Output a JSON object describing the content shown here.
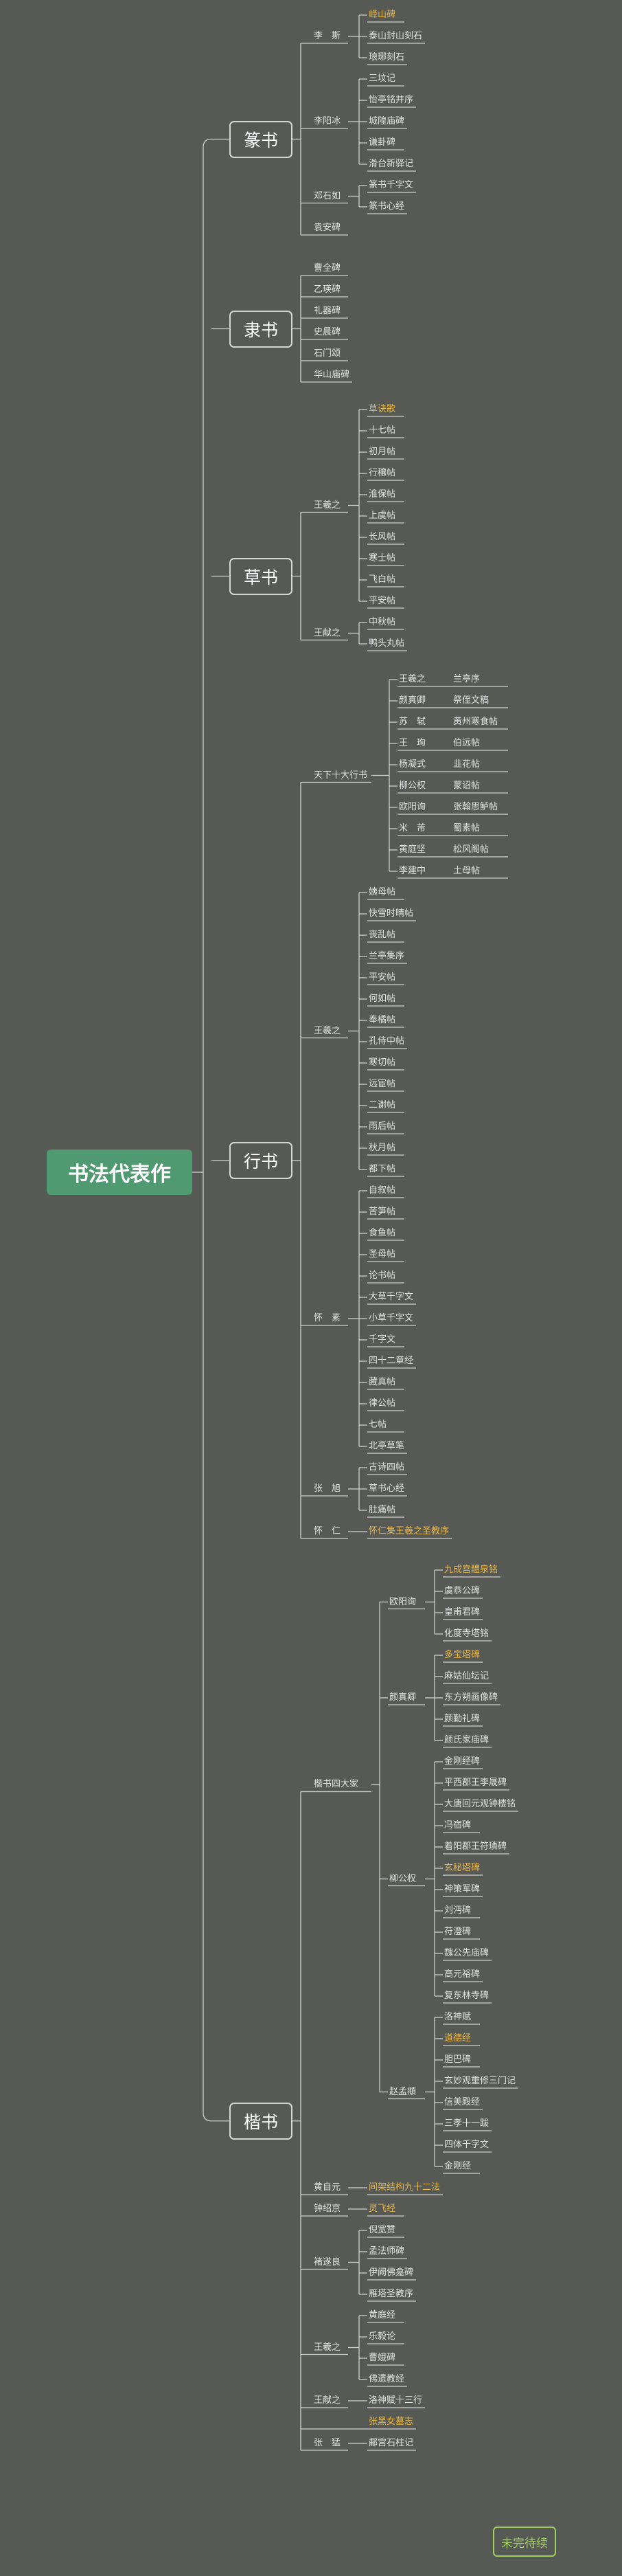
{
  "root": "书法代表作",
  "footer": "未完待续",
  "colors": {
    "background": "#575955",
    "root": "#4f9a70",
    "line": "#cfcfcf",
    "highlight": "#e9b84a",
    "footer": "#9fce5e"
  },
  "categories": [
    {
      "name": "篆书",
      "groups": [
        {
          "name": "李　斯",
          "items": [
            {
              "t": "峄山碑",
              "hl": true
            },
            {
              "t": "泰山封山刻石"
            },
            {
              "t": "琅琊刻石"
            }
          ]
        },
        {
          "name": "李阳冰",
          "items": [
            {
              "t": "三坟记"
            },
            {
              "t": "怡亭铭并序"
            },
            {
              "t": "城隍庙碑"
            },
            {
              "t": "谦卦碑"
            },
            {
              "t": "滑台新驿记"
            }
          ]
        },
        {
          "name": "邓石如",
          "items": [
            {
              "t": "篆书千字文"
            },
            {
              "t": "篆书心经"
            }
          ]
        },
        {
          "name": "袁安碑",
          "items": []
        }
      ]
    },
    {
      "name": "隶书",
      "groups": [
        {
          "name": "曹全碑",
          "items": []
        },
        {
          "name": "乙瑛碑",
          "items": []
        },
        {
          "name": "礼器碑",
          "items": []
        },
        {
          "name": "史晨碑",
          "items": []
        },
        {
          "name": "石门颂",
          "items": []
        },
        {
          "name": "华山庙碑",
          "items": []
        }
      ]
    },
    {
      "name": "草书",
      "groups": [
        {
          "name": "王羲之",
          "items": [
            {
              "t": "草诀歌",
              "hl": true
            },
            {
              "t": "十七帖"
            },
            {
              "t": "初月帖"
            },
            {
              "t": "行穰帖"
            },
            {
              "t": "淮保帖"
            },
            {
              "t": "上虞帖"
            },
            {
              "t": "长风帖"
            },
            {
              "t": "寒士帖"
            },
            {
              "t": "飞白帖"
            },
            {
              "t": "平安帖"
            }
          ]
        },
        {
          "name": "王献之",
          "items": [
            {
              "t": "中秋帖"
            },
            {
              "t": "鸭头丸帖"
            }
          ]
        }
      ]
    },
    {
      "name": "行书",
      "groups": [
        {
          "name": "天下十大行书",
          "pairs": [
            [
              "王羲之",
              "兰亭序"
            ],
            [
              "颜真卿",
              "祭侄文稿"
            ],
            [
              "苏　轼",
              "黄州寒食帖"
            ],
            [
              "王　珣",
              "伯远帖"
            ],
            [
              "杨凝式",
              "韭花帖"
            ],
            [
              "柳公权",
              "蒙诏帖"
            ],
            [
              "欧阳询",
              "张翰思鲈帖"
            ],
            [
              "米　芾",
              "蜀素帖"
            ],
            [
              "黄庭坚",
              "松风阁帖"
            ],
            [
              "李建中",
              "土母帖"
            ]
          ]
        },
        {
          "name": "王羲之",
          "items": [
            {
              "t": "姨母帖"
            },
            {
              "t": "快雪时晴帖"
            },
            {
              "t": "丧乱帖"
            },
            {
              "t": "兰亭集序"
            },
            {
              "t": "平安帖"
            },
            {
              "t": "何如帖"
            },
            {
              "t": "奉橘帖"
            },
            {
              "t": "孔侍中帖"
            },
            {
              "t": "寒切帖"
            },
            {
              "t": "远宦帖"
            },
            {
              "t": "二谢帖"
            },
            {
              "t": "雨后帖"
            },
            {
              "t": "秋月帖"
            },
            {
              "t": "都下帖"
            }
          ]
        },
        {
          "name": "怀　素",
          "items": [
            {
              "t": "自叙帖"
            },
            {
              "t": "苦笋帖"
            },
            {
              "t": "食鱼帖"
            },
            {
              "t": "圣母帖"
            },
            {
              "t": "论书帖"
            },
            {
              "t": "大草千字文"
            },
            {
              "t": "小草千字文"
            },
            {
              "t": "千字文"
            },
            {
              "t": "四十二章经"
            },
            {
              "t": "藏真帖"
            },
            {
              "t": "律公帖"
            },
            {
              "t": "七帖"
            },
            {
              "t": "北亭草笔"
            }
          ]
        },
        {
          "name": "张　旭",
          "items": [
            {
              "t": "古诗四帖"
            },
            {
              "t": "草书心经"
            },
            {
              "t": "肚痛帖"
            }
          ]
        },
        {
          "name": "怀　仁",
          "items": [
            {
              "t": "怀仁集王羲之圣教序",
              "hl": true
            }
          ]
        }
      ]
    },
    {
      "name": "楷书",
      "groups": [
        {
          "name": "楷书四大家",
          "subs": [
            {
              "name": "欧阳询",
              "items": [
                {
                  "t": "九成宫醴泉铭",
                  "hl": true
                },
                {
                  "t": "虞恭公碑"
                },
                {
                  "t": "皇甫君碑"
                },
                {
                  "t": "化度寺塔铭"
                }
              ]
            },
            {
              "name": "颜真卿",
              "items": [
                {
                  "t": "多宝塔碑",
                  "hl": true
                },
                {
                  "t": "麻姑仙坛记"
                },
                {
                  "t": "东方朔画像碑"
                },
                {
                  "t": "颜勤礼碑"
                },
                {
                  "t": "颜氏家庙碑"
                }
              ]
            },
            {
              "name": "柳公权",
              "items": [
                {
                  "t": "金刚经碑"
                },
                {
                  "t": "平西郡王李晟碑"
                },
                {
                  "t": "大唐回元观钟楼铭"
                },
                {
                  "t": "冯宿碑"
                },
                {
                  "t": "着阳郡王符璘碑"
                },
                {
                  "t": "玄秘塔碑",
                  "hl": true
                },
                {
                  "t": "神策军碑"
                },
                {
                  "t": "刘沔碑"
                },
                {
                  "t": "苻澄碑"
                },
                {
                  "t": "魏公先庙碑"
                },
                {
                  "t": "高元裕碑"
                },
                {
                  "t": "复东林寺碑"
                }
              ]
            },
            {
              "name": "赵孟頫",
              "items": [
                {
                  "t": "洛神赋"
                },
                {
                  "t": "道德经",
                  "hl": true
                },
                {
                  "t": "胆巴碑"
                },
                {
                  "t": "玄妙观重修三门记"
                },
                {
                  "t": "信美殿经"
                },
                {
                  "t": "三孝十一跋"
                },
                {
                  "t": "四体千字文"
                },
                {
                  "t": "金刚经"
                }
              ]
            }
          ]
        },
        {
          "name": "黄自元",
          "items": [
            {
              "t": "间架结构九十二法",
              "hl": true
            }
          ]
        },
        {
          "name": "钟绍京",
          "items": [
            {
              "t": "灵飞经",
              "hl": true
            }
          ]
        },
        {
          "name": "褚遂良",
          "items": [
            {
              "t": "倪宽赞"
            },
            {
              "t": "孟法师碑"
            },
            {
              "t": "伊阙佛龛碑"
            },
            {
              "t": "雁塔圣教序"
            }
          ]
        },
        {
          "name": "王羲之",
          "items": [
            {
              "t": "黄庭经"
            },
            {
              "t": "乐毅论"
            },
            {
              "t": "曹娥碑"
            },
            {
              "t": "佛遗教经"
            }
          ]
        },
        {
          "name": "王献之",
          "items": [
            {
              "t": "洛神赋十三行"
            }
          ]
        },
        {
          "name": "",
          "items": [
            {
              "t": "张黑女墓志",
              "hl": true
            }
          ]
        },
        {
          "name": "张　猛",
          "items": [
            {
              "t": "郙宫石柱记"
            }
          ]
        }
      ]
    }
  ]
}
